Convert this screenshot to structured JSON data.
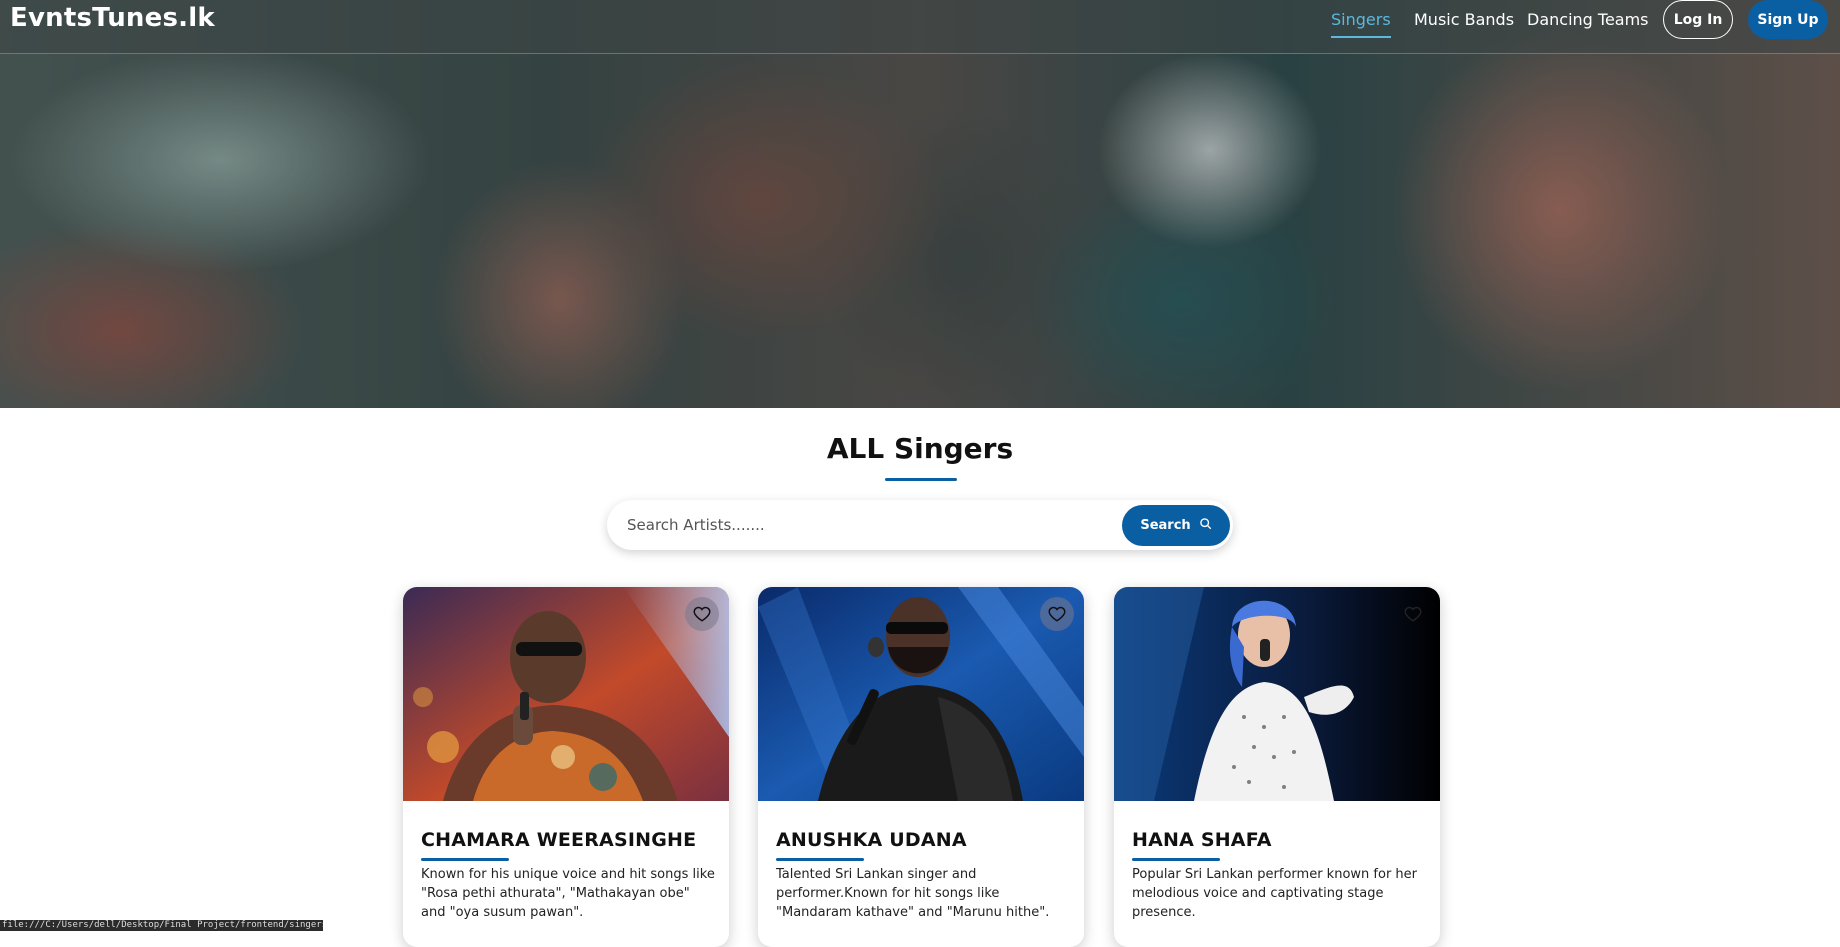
{
  "header": {
    "logo": "EvntsTunes.lk",
    "nav": [
      {
        "label": "Singers",
        "active": true
      },
      {
        "label": "Music Bands",
        "active": false
      },
      {
        "label": "Dancing Teams",
        "active": false
      }
    ],
    "login_label": "Log In",
    "signup_label": "Sign Up"
  },
  "main": {
    "title": "ALL Singers",
    "search": {
      "placeholder": "Search Artists.......",
      "value": "",
      "button_label": "Search"
    },
    "artists": [
      {
        "name": "CHAMARA WEERASINGHE",
        "description": "Known for his unique voice and hit songs like \"Rosa pethi athurata\", \"Mathakayan obe\" and \"oya susum pawan\"."
      },
      {
        "name": "ANUSHKA UDANA",
        "description": "Talented Sri Lankan singer and performer.Known for hit songs like \"Mandaram kathave\" and \"Marunu hithe\"."
      },
      {
        "name": "HANA SHAFA",
        "description": "Popular Sri Lankan performer known for her melodious voice and captivating stage presence."
      }
    ]
  },
  "status_bar": {
    "text": "file:///C:/Users/dell/Desktop/Final Project/frontend/singers.html"
  },
  "colors": {
    "accent": "#0a5fa3",
    "active_nav": "#5bb8e0"
  }
}
